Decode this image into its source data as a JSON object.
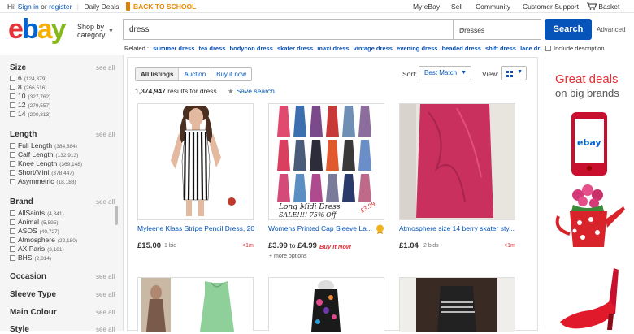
{
  "topbar": {
    "greeting": "Hi!",
    "sign_in": "Sign in",
    "or": "or",
    "register": "register",
    "daily_deals": "Daily Deals",
    "promo": "BACK TO SCHOOL",
    "my_ebay": "My eBay",
    "sell": "Sell",
    "community": "Community",
    "customer_support": "Customer Support",
    "basket": "Basket"
  },
  "header": {
    "logo": [
      "e",
      "b",
      "a",
      "y"
    ],
    "logo_colors": [
      "#e53238",
      "#0064d2",
      "#f5af02",
      "#86b817"
    ],
    "shop_by_1": "Shop by",
    "shop_by_2": "category",
    "search_value": "dress",
    "category_value": "Dresses",
    "search_button": "Search",
    "advanced": "Advanced",
    "include_description": "Include description"
  },
  "related": {
    "label": "Related :",
    "items": [
      "summer dress",
      "tea dress",
      "bodycon dress",
      "skater dress",
      "maxi dress",
      "vintage dress",
      "evening dress",
      "beaded dress",
      "shift dress",
      "lace dr..."
    ]
  },
  "sidebar": {
    "see_all": "see all",
    "size": {
      "title": "Size",
      "items": [
        {
          "label": "6",
          "count": "(124,379)"
        },
        {
          "label": "8",
          "count": "(266,516)"
        },
        {
          "label": "10",
          "count": "(327,762)"
        },
        {
          "label": "12",
          "count": "(279,557)"
        },
        {
          "label": "14",
          "count": "(200,813)"
        }
      ]
    },
    "length": {
      "title": "Length",
      "items": [
        {
          "label": "Full Length",
          "count": "(384,884)"
        },
        {
          "label": "Calf Length",
          "count": "(132,913)"
        },
        {
          "label": "Knee Length",
          "count": "(369,148)"
        },
        {
          "label": "Short/Mini",
          "count": "(378,447)"
        },
        {
          "label": "Asymmetric",
          "count": "(18,188)"
        }
      ]
    },
    "brand": {
      "title": "Brand",
      "items": [
        {
          "label": "AllSaints",
          "count": "(4,341)"
        },
        {
          "label": "Animal",
          "count": "(5,595)"
        },
        {
          "label": "ASOS",
          "count": "(40,727)"
        },
        {
          "label": "Atmosphere",
          "count": "(22,180)"
        },
        {
          "label": "AX Paris",
          "count": "(3,181)"
        },
        {
          "label": "BHS",
          "count": "(2,814)"
        }
      ]
    },
    "collapsed": [
      "Occasion",
      "Sleeve Type",
      "Main Colour",
      "Style"
    ]
  },
  "listing": {
    "tabs": [
      "All listings",
      "Auction",
      "Buy it now"
    ],
    "results_count": "1,374,947",
    "results_text": "results for dress",
    "save_search": "Save search",
    "sort_label": "Sort:",
    "sort_value": "Best Match",
    "view_label": "View:"
  },
  "items": [
    {
      "title": "Myleene Klass Stripe Pencil Dress, 20",
      "price": "£15.00",
      "bids": "1 bid",
      "time": "<1m"
    },
    {
      "title": "Womens Printed Cap Sleeve La...",
      "price_from": "£3.99",
      "to": "to",
      "price_to": "£4.99",
      "buy_it_now": "Buy It Now",
      "more_options": "+ more options",
      "img_text_1": "Long Midi Dress",
      "img_text_2": "SALE!!!! 75% Off",
      "img_price": "£3.99"
    },
    {
      "title": "Atmosphere size 14 berry skater sty...",
      "price": "£1.04",
      "bids": "2 bids",
      "time": "<1m"
    }
  ],
  "ad": {
    "line1": "Great deals",
    "line2": "on big brands",
    "phone_logo": "ebay"
  }
}
